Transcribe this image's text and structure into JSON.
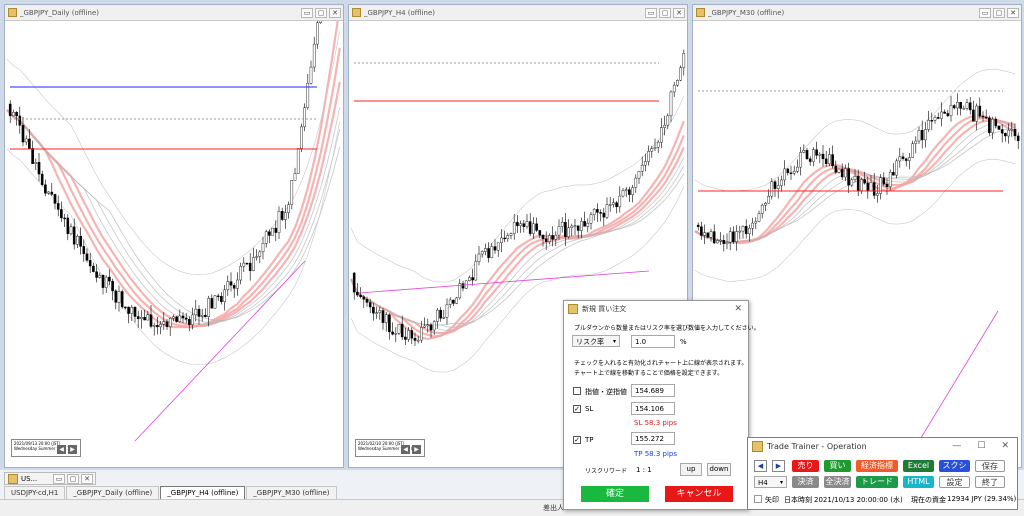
{
  "windows": [
    {
      "title": "_GBPJPY_Daily (offline)",
      "buttons": [
        "▭",
        "▢",
        "✕"
      ],
      "info": "2021/09/13 20:00 (JST) Wednesday Summer time 1/1"
    },
    {
      "title": "_GBPJPY_H4 (offline)",
      "buttons": [
        "▭",
        "▢",
        "✕"
      ],
      "info": "2021/02/10 20:00 (JST) Wednesday Summer time 88"
    },
    {
      "title": "_GBPJPY_M30 (offline)",
      "buttons": [
        "▭",
        "▢",
        "✕"
      ]
    }
  ],
  "colors": {
    "candle_up": "#ffffff",
    "candle_down": "#000000",
    "line_blue": "#2020ff",
    "line_red": "#ff2020",
    "band_red": "#f4a0a0",
    "ma_gray": "#b8b8b8",
    "line_pink": "#e040e0"
  },
  "minimized_window": {
    "title": "US...",
    "buttons": [
      "▭",
      "▢",
      "✕"
    ]
  },
  "tabs": [
    "USDJPY-cd,H1",
    "_GBPJPY_Daily (offline)",
    "_GBPJPY_H4 (offline)",
    "_GBPJPY_M30 (offline)"
  ],
  "active_tab": "_GBPJPY_H4 (offline)",
  "status_text": "差出人",
  "order_dialog": {
    "title": "新規 買い注文",
    "close": "✕",
    "instruction": "プルダウンから数量またはリスク率を選び数値を入力してください。",
    "mode_select": "リスク率",
    "mode_value": "1.0",
    "mode_unit": "%",
    "note_line1": "チェックを入れると有効化されチャート上に線が表示されます。",
    "note_line2": "チャート上で線を移動することで価格を設定できます。",
    "limit_label": "指値・逆指値",
    "limit_checked": false,
    "limit_value": "154.689",
    "sl_label": "SL",
    "sl_checked": true,
    "sl_value": "154.106",
    "sl_pips": "SL 58.3 pips",
    "tp_label": "TP",
    "tp_checked": true,
    "tp_value": "155.272",
    "tp_pips": "TP 58.3 pips",
    "rr_label": "リスクリワード",
    "rr_value": "1 : 1",
    "up": "up",
    "down": "down",
    "confirm": "確定",
    "cancel": "キャンセル"
  },
  "trainer": {
    "title": "Trade Trainer - Operation",
    "controls": [
      "—",
      "☐",
      "✕"
    ],
    "prev": "◀",
    "next": "▶",
    "sell": "売り",
    "buy": "買い",
    "indicators": "経済指標",
    "excel": "Excel",
    "screenshot": "スクショ",
    "save": "保存",
    "timeframe": "H4",
    "settle": "決済",
    "settle_all": "全決済",
    "trade": "トレード",
    "html": "HTML",
    "settings": "設定",
    "exit": "終了",
    "dim_label": "矢印",
    "time_label": "日本時刻",
    "time_value": "2021/10/13 20:00:00 (水)",
    "funds_label": "現在の資金",
    "funds_value": "12934 JPY (29.34%)"
  }
}
